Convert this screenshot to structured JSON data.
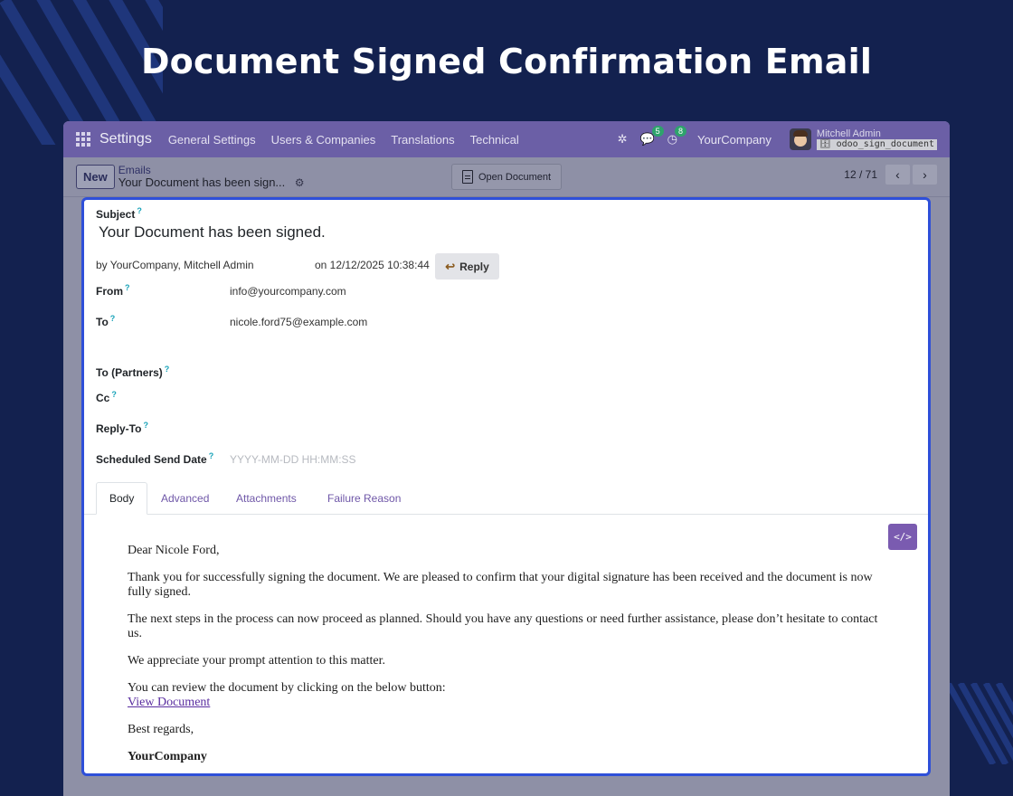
{
  "banner": {
    "title": "Document Signed Confirmation Email"
  },
  "navbar": {
    "app_name": "Settings",
    "menu": [
      "General Settings",
      "Users & Companies",
      "Translations",
      "Technical"
    ],
    "messages_count": "5",
    "activities_count": "8",
    "company": "YourCompany",
    "user_name": "Mitchell Admin",
    "database": "odoo_sign_document"
  },
  "control_panel": {
    "new_label": "New",
    "breadcrumb_parent": "Emails",
    "breadcrumb_current": "Your Document has been sign...",
    "open_document_label": "Open Document",
    "pager_value": "12 / 71"
  },
  "form": {
    "subject_label": "Subject",
    "subject": "Your Document has been signed.",
    "byline": "by  YourCompany, Mitchell Admin",
    "date": "on 12/12/2025 10:38:44",
    "reply_label": "Reply",
    "fields": {
      "from_label": "From",
      "from_value": "info@yourcompany.com",
      "to_label": "To",
      "to_value": "nicole.ford75@example.com",
      "to_partners_label": "To (Partners)",
      "cc_label": "Cc",
      "reply_to_label": "Reply-To",
      "scheduled_label": "Scheduled Send Date",
      "scheduled_placeholder": "YYYY-MM-DD HH:MM:SS"
    },
    "tabs": [
      "Body",
      "Advanced",
      "Attachments",
      "Failure Reason"
    ]
  },
  "email_body": {
    "greeting": "Dear Nicole Ford,",
    "p1": "Thank you for successfully signing the document. We are pleased to confirm that your digital signature has been received and the document is now fully signed.",
    "p2": "The next steps in the process can now proceed as planned. Should you have any questions or need further assistance, please don’t hesitate to contact us.",
    "p3": "We appreciate your prompt attention to this matter.",
    "p4": "You can review the document by clicking on the below button:",
    "link": "View Document",
    "closing": "Best regards,",
    "signature": "YourCompany"
  },
  "colors": {
    "background": "#13214f",
    "navbar": "#6b5fa6",
    "focus_border": "#2e4fd9",
    "accent": "#7a5bb0"
  }
}
